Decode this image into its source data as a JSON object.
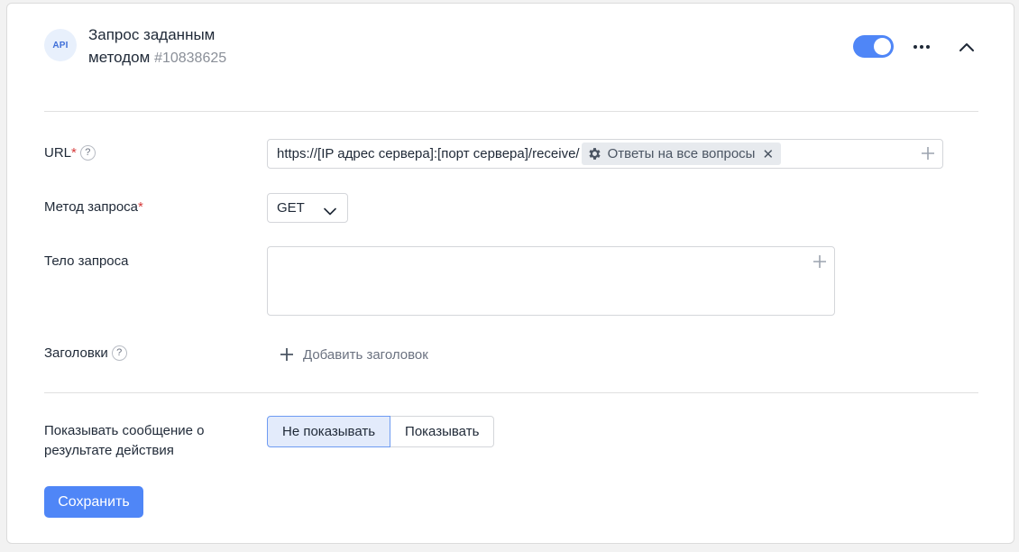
{
  "header": {
    "badge": "API",
    "title_line1": "Запрос заданным",
    "title_line2": "методом",
    "id": "#10838625",
    "enabled": true
  },
  "form": {
    "url": {
      "label": "URL",
      "required_mark": "*",
      "help": "?",
      "value": "https://[IP адрес сервера]:[порт сервера]/receive/",
      "chip": "Ответы на все вопросы"
    },
    "method": {
      "label": "Метод запроса",
      "required_mark": "*",
      "selected": "GET"
    },
    "body": {
      "label": "Тело запроса",
      "value": ""
    },
    "headers": {
      "label": "Заголовки",
      "help": "?",
      "add_label": "Добавить заголовок"
    },
    "show_result": {
      "label_line1": "Показывать сообщение о",
      "label_line2": "результате действия",
      "options": [
        "Не показывать",
        "Показывать"
      ],
      "selected": "Не показывать"
    }
  },
  "actions": {
    "save_label": "Сохранить"
  },
  "colors": {
    "accent": "#4f86f7",
    "required": "#d63a3a"
  },
  "icons": {
    "chip_icon": "gear-icon",
    "chip_remove": "close-icon",
    "add": "plus-icon",
    "menu": "more-dots-icon",
    "collapse": "chevron-up-icon",
    "select": "chevron-down-icon"
  }
}
